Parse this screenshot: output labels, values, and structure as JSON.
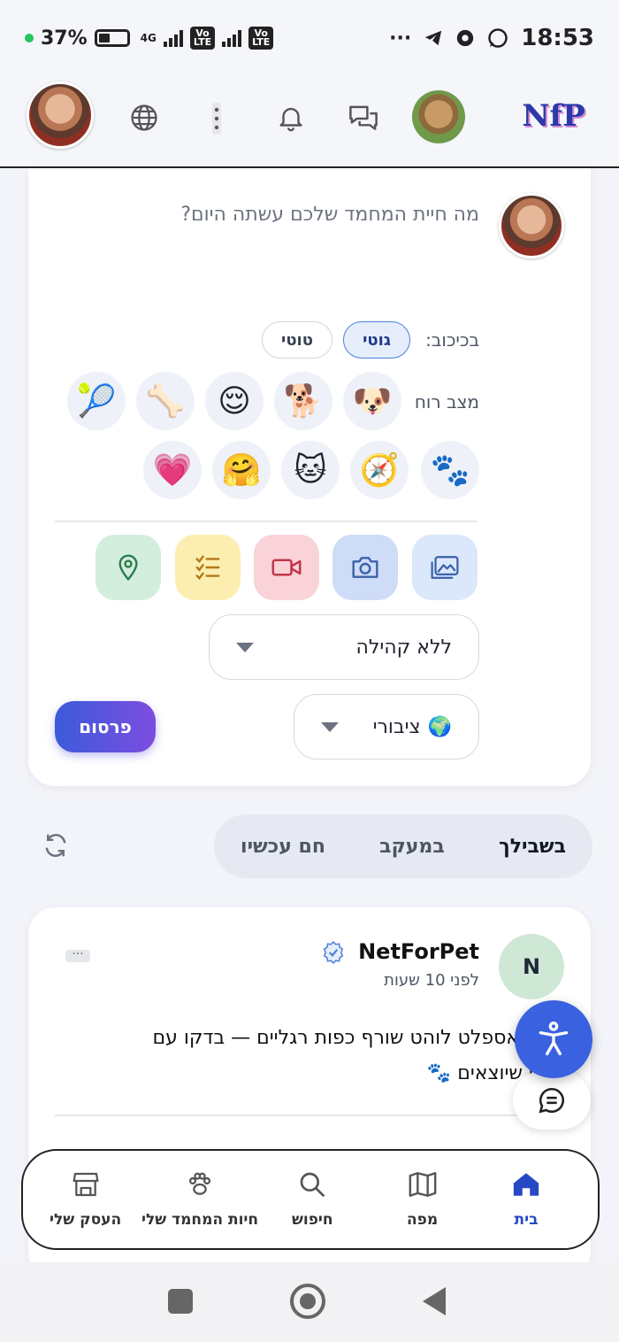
{
  "status": {
    "battery": "37%",
    "network": "4G",
    "volte": "Vo LTE",
    "more": "···",
    "time": "18:53"
  },
  "header": {
    "logo_text": "NfP",
    "icons": [
      "profile-avatar",
      "globe-icon",
      "kebab-menu-icon",
      "bell-icon",
      "chat-icon",
      "pet-avatar",
      "app-logo"
    ]
  },
  "composer": {
    "placeholder": "מה חיית המחמד שלכם עשתה היום?",
    "starring_label": "בכיכוב:",
    "pets": [
      {
        "name": "גוטי",
        "selected": true
      },
      {
        "name": "טוטי",
        "selected": false
      }
    ],
    "mood_label": "מצב רוח",
    "moods_row1": [
      "🐶",
      "🐕",
      "😌",
      "🦴",
      "🎾"
    ],
    "moods_row2": [
      "🐾",
      "🧭",
      "🐱",
      "🤗",
      "💗"
    ],
    "tools": [
      "image-icon",
      "camera-icon",
      "video-icon",
      "checklist-icon",
      "location-icon"
    ],
    "community_select": "ללא קהילה",
    "privacy_emoji": "🌍",
    "privacy_select": "ציבורי",
    "publish_label": "פרסום"
  },
  "feed": {
    "tabs": [
      "בשבילך",
      "במעקב",
      "חם עכשיו"
    ],
    "active_tab": "בשבילך"
  },
  "post": {
    "avatar_letter": "N",
    "author": "NetForPet",
    "time": "לפני 10 שעות",
    "more": "···",
    "body_line1": "חוץ? אספלט לוהט שורף כפות רגליים — בדקו עם",
    "body_line2": "לפני שיוצאים 🐾"
  },
  "bottom_nav": {
    "items": [
      {
        "label": "בית",
        "active": true
      },
      {
        "label": "מפה",
        "active": false
      },
      {
        "label": "חיפוש",
        "active": false
      },
      {
        "label": "חיות המחמד שלי",
        "active": false
      },
      {
        "label": "העסק שלי",
        "active": false
      }
    ]
  },
  "colors": {
    "accent": "#3a62e0",
    "publish_start": "#3b5bdb",
    "publish_end": "#7c4ddf"
  }
}
